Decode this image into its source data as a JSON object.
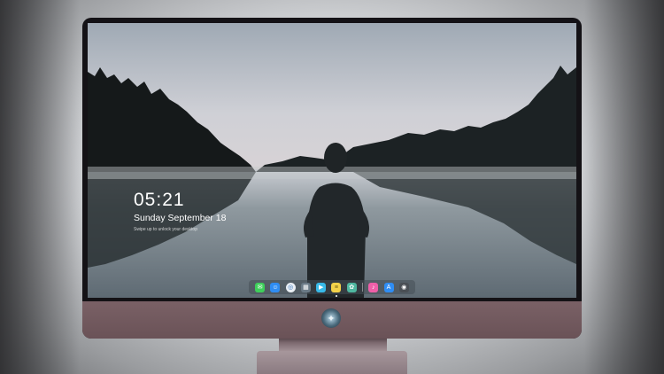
{
  "lock_screen": {
    "time": "05:21",
    "date": "Sunday September 18",
    "subtext": "Swipe up to unlock your desktop"
  },
  "dock": {
    "items": [
      {
        "name": "messages-icon",
        "color": "#3ecf5a"
      },
      {
        "name": "finder-icon",
        "color": "#2f8df3"
      },
      {
        "name": "safari-icon",
        "color": "#e9eef4"
      },
      {
        "name": "launchpad-icon",
        "color": "#6b7a86"
      },
      {
        "name": "video-icon",
        "color": "#38b9e8"
      },
      {
        "name": "notes-icon",
        "color": "#f4d24a"
      },
      {
        "name": "photos-icon",
        "color": "#4fb7a0"
      },
      {
        "name": "music-icon",
        "color": "#ee5fa8"
      },
      {
        "name": "app-store-icon",
        "color": "#2f8df3"
      },
      {
        "name": "camera-icon",
        "color": "#4a4f55"
      }
    ]
  }
}
